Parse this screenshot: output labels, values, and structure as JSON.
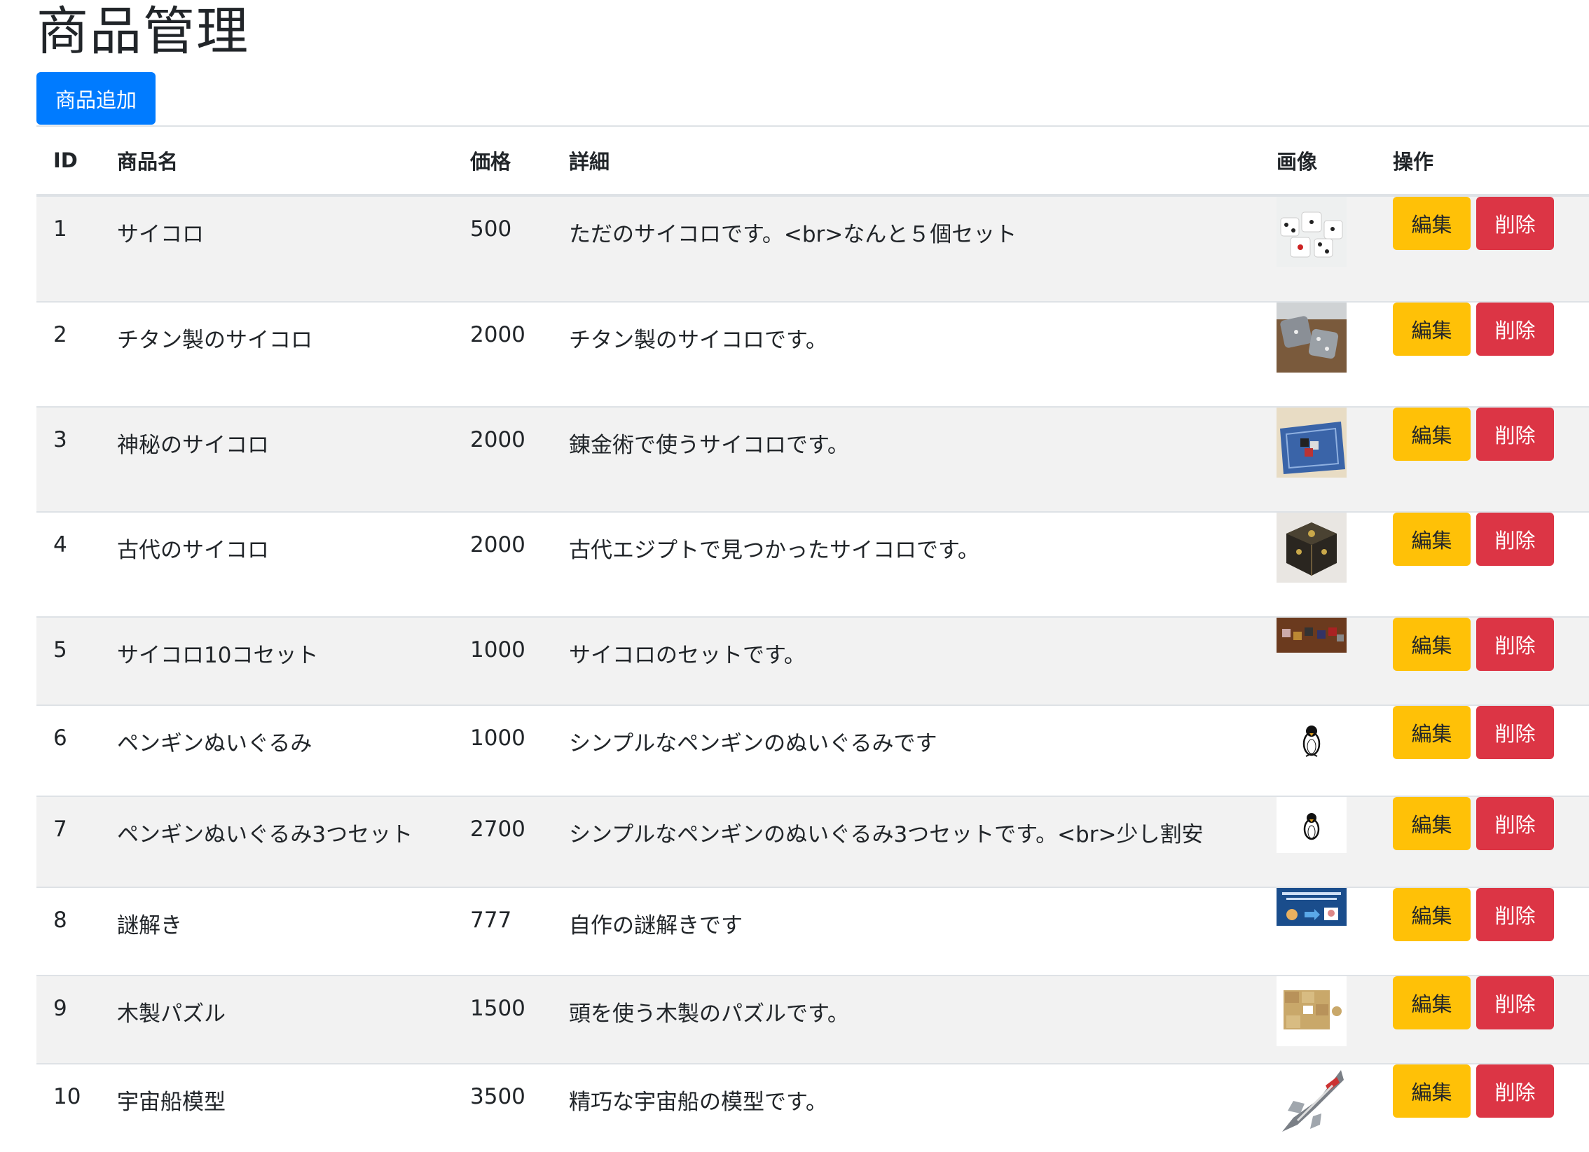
{
  "page": {
    "title": "商品管理",
    "add_button": "商品追加"
  },
  "table": {
    "headers": [
      "ID",
      "商品名",
      "価格",
      "詳細",
      "画像",
      "操作"
    ],
    "rows": [
      {
        "id": "1",
        "name": "サイコロ",
        "price": "500",
        "detail": "ただのサイコロです。<br>なんと５個セット",
        "image": "white-dice-photo",
        "edit": "編集",
        "delete": "削除"
      },
      {
        "id": "2",
        "name": "チタン製のサイコロ",
        "price": "2000",
        "detail": "チタン製のサイコロです。",
        "image": "titanium-dice-photo",
        "edit": "編集",
        "delete": "削除"
      },
      {
        "id": "3",
        "name": "神秘のサイコロ",
        "price": "2000",
        "detail": "錬金術で使うサイコロです。",
        "image": "mystic-dice-photo",
        "edit": "編集",
        "delete": "削除"
      },
      {
        "id": "4",
        "name": "古代のサイコロ",
        "price": "2000",
        "detail": "古代エジプトで見つかったサイコロです。",
        "image": "ancient-dice-photo",
        "edit": "編集",
        "delete": "削除"
      },
      {
        "id": "5",
        "name": "サイコロ10コセット",
        "price": "1000",
        "detail": "サイコロのセットです。",
        "image": "dice-set-photo",
        "edit": "編集",
        "delete": "削除"
      },
      {
        "id": "6",
        "name": "ペンギンぬいぐるみ",
        "price": "1000",
        "detail": "シンプルなペンギンのぬいぐるみです",
        "image": "penguin-plush-icon",
        "edit": "編集",
        "delete": "削除"
      },
      {
        "id": "7",
        "name": "ペンギンぬいぐるみ3つセット",
        "price": "2700",
        "detail": "シンプルなペンギンのぬいぐるみ3つセットです。<br>少し割安",
        "image": "penguin-set-icon",
        "edit": "編集",
        "delete": "削除"
      },
      {
        "id": "8",
        "name": "謎解き",
        "price": "777",
        "detail": "自作の謎解きです",
        "image": "puzzle-game-banner",
        "edit": "編集",
        "delete": "削除"
      },
      {
        "id": "9",
        "name": "木製パズル",
        "price": "1500",
        "detail": "頭を使う木製のパズルです。",
        "image": "wooden-puzzle-photo",
        "edit": "編集",
        "delete": "削除"
      },
      {
        "id": "10",
        "name": "宇宙船模型",
        "price": "3500",
        "detail": "精巧な宇宙船の模型です。",
        "image": "spaceship-model-photo",
        "edit": "編集",
        "delete": "削除"
      }
    ]
  },
  "colors": {
    "primary": "#007bff",
    "warning": "#ffc107",
    "danger": "#dc3545",
    "stripe": "#f2f2f2"
  }
}
